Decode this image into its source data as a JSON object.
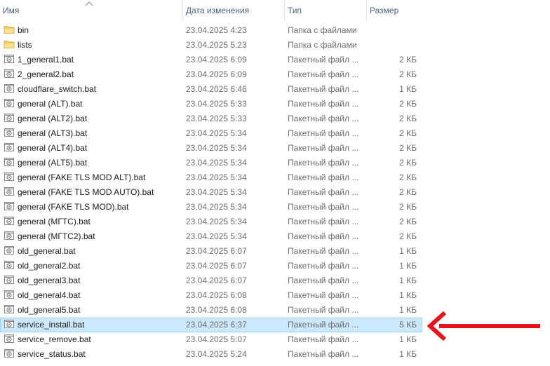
{
  "columns": {
    "name": "Имя",
    "modified": "Дата изменения",
    "type": "Тип",
    "size": "Размер"
  },
  "files": [
    {
      "name": "bin",
      "modified": "23.04.2025 4:23",
      "type": "Папка с файлами",
      "size": "",
      "icon": "folder-icon"
    },
    {
      "name": "lists",
      "modified": "23.04.2025 5:23",
      "type": "Папка с файлами",
      "size": "",
      "icon": "folder-icon"
    },
    {
      "name": "1_general1.bat",
      "modified": "23.04.2025 6:09",
      "type": "Пакетный файл ...",
      "size": "2 КБ",
      "icon": "batch-file-icon"
    },
    {
      "name": "2_general2.bat",
      "modified": "23.04.2025 6:09",
      "type": "Пакетный файл ...",
      "size": "2 КБ",
      "icon": "batch-file-icon"
    },
    {
      "name": "cloudflare_switch.bat",
      "modified": "23.04.2025 6:46",
      "type": "Пакетный файл ...",
      "size": "1 КБ",
      "icon": "batch-file-icon"
    },
    {
      "name": "general (ALT).bat",
      "modified": "23.04.2025 5:33",
      "type": "Пакетный файл ...",
      "size": "2 КБ",
      "icon": "batch-file-icon"
    },
    {
      "name": "general (ALT2).bat",
      "modified": "23.04.2025 5:33",
      "type": "Пакетный файл ...",
      "size": "2 КБ",
      "icon": "batch-file-icon"
    },
    {
      "name": "general (ALT3).bat",
      "modified": "23.04.2025 5:34",
      "type": "Пакетный файл ...",
      "size": "2 КБ",
      "icon": "batch-file-icon"
    },
    {
      "name": "general (ALT4).bat",
      "modified": "23.04.2025 5:34",
      "type": "Пакетный файл ...",
      "size": "2 КБ",
      "icon": "batch-file-icon"
    },
    {
      "name": "general (ALT5).bat",
      "modified": "23.04.2025 5:34",
      "type": "Пакетный файл ...",
      "size": "2 КБ",
      "icon": "batch-file-icon"
    },
    {
      "name": "general (FAKE TLS MOD ALT).bat",
      "modified": "23.04.2025 5:34",
      "type": "Пакетный файл ...",
      "size": "2 КБ",
      "icon": "batch-file-icon"
    },
    {
      "name": "general (FAKE TLS MOD AUTO).bat",
      "modified": "23.04.2025 5:34",
      "type": "Пакетный файл ...",
      "size": "2 КБ",
      "icon": "batch-file-icon"
    },
    {
      "name": "general (FAKE TLS MOD).bat",
      "modified": "23.04.2025 5:34",
      "type": "Пакетный файл ...",
      "size": "2 КБ",
      "icon": "batch-file-icon"
    },
    {
      "name": "general (МГТС).bat",
      "modified": "23.04.2025 5:34",
      "type": "Пакетный файл ...",
      "size": "2 КБ",
      "icon": "batch-file-icon"
    },
    {
      "name": "general (МГТС2).bat",
      "modified": "23.04.2025 5:34",
      "type": "Пакетный файл ...",
      "size": "2 КБ",
      "icon": "batch-file-icon"
    },
    {
      "name": "old_general.bat",
      "modified": "23.04.2025 6:07",
      "type": "Пакетный файл ...",
      "size": "1 КБ",
      "icon": "batch-file-icon"
    },
    {
      "name": "old_general2.bat",
      "modified": "23.04.2025 6:07",
      "type": "Пакетный файл ...",
      "size": "1 КБ",
      "icon": "batch-file-icon"
    },
    {
      "name": "old_general3.bat",
      "modified": "23.04.2025 6:07",
      "type": "Пакетный файл ...",
      "size": "1 КБ",
      "icon": "batch-file-icon"
    },
    {
      "name": "old_general4.bat",
      "modified": "23.04.2025 6:08",
      "type": "Пакетный файл ...",
      "size": "1 КБ",
      "icon": "batch-file-icon"
    },
    {
      "name": "old_general5.bat",
      "modified": "23.04.2025 6:08",
      "type": "Пакетный файл ...",
      "size": "1 КБ",
      "icon": "batch-file-icon"
    },
    {
      "name": "service_install.bat",
      "modified": "23.04.2025 6:37",
      "type": "Пакетный файл ...",
      "size": "5 КБ",
      "icon": "batch-file-icon",
      "selected": true
    },
    {
      "name": "service_remove.bat",
      "modified": "23.04.2025 5:07",
      "type": "Пакетный файл ...",
      "size": "1 КБ",
      "icon": "batch-file-icon"
    },
    {
      "name": "service_status.bat",
      "modified": "23.04.2025 5:24",
      "type": "Пакетный файл ...",
      "size": "1 КБ",
      "icon": "batch-file-icon"
    }
  ],
  "colors": {
    "selection_bg": "#cce8ff",
    "selection_border": "#99d1ff",
    "header_text": "#4c607a",
    "annotation_arrow": "#e8141c",
    "folder": "#f8d775"
  }
}
